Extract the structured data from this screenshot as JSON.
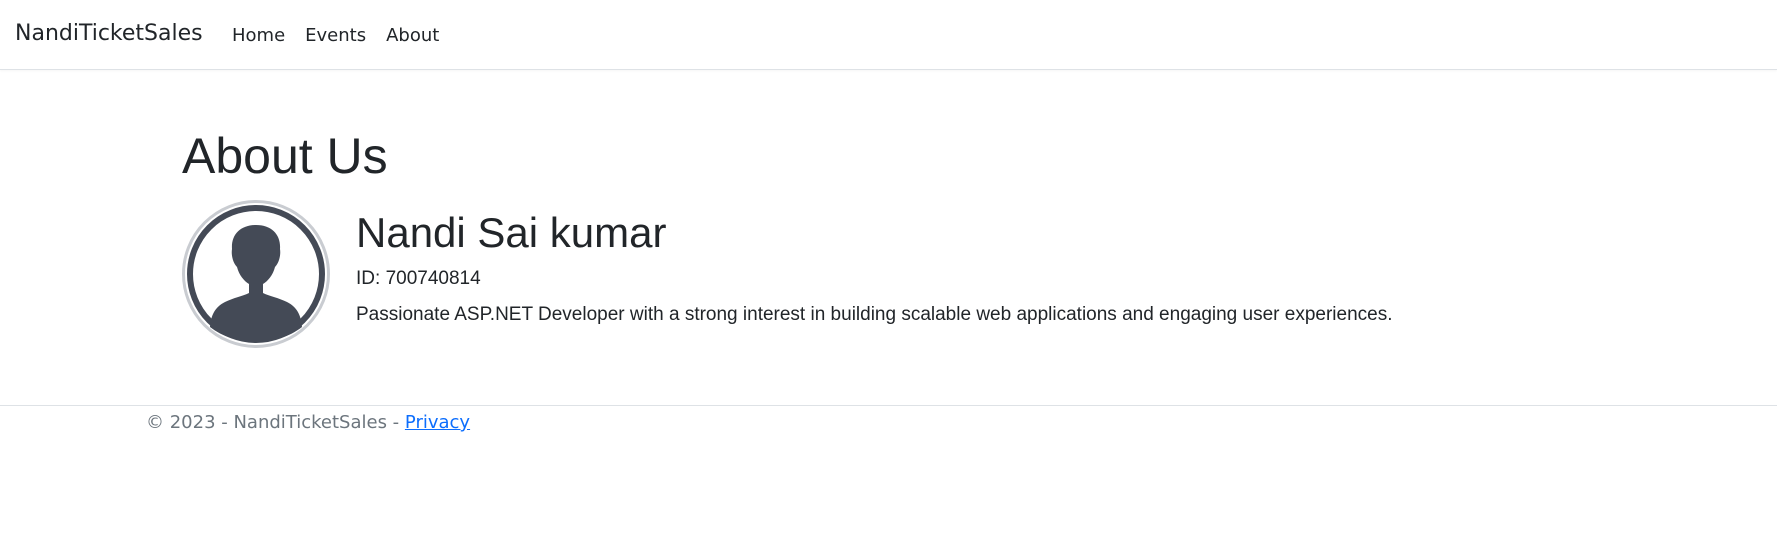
{
  "navbar": {
    "brand": "NandiTicketSales",
    "links": [
      {
        "label": "Home"
      },
      {
        "label": "Events"
      },
      {
        "label": "About"
      }
    ]
  },
  "main": {
    "title": "About Us",
    "profile": {
      "avatar_icon": "user-silhouette-icon",
      "name": "Nandi Sai kumar",
      "id_label": "ID:",
      "id_value": "700740814",
      "bio": "Passionate ASP.NET Developer with a strong interest in building scalable web applications and engaging user experiences."
    }
  },
  "footer": {
    "copyright": "© 2023 - NandiTicketSales - ",
    "privacy_link": "Privacy"
  },
  "colors": {
    "text": "#212529",
    "muted": "#6c757d",
    "link": "#0d6efd",
    "border": "#dee2e6",
    "avatar_fill": "#444a56"
  }
}
